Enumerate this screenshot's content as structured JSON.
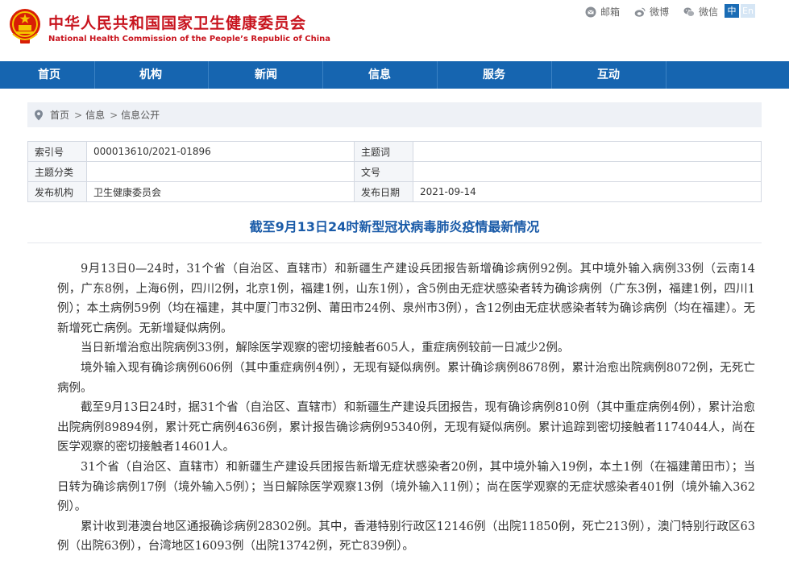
{
  "header": {
    "title_cn": "中华人民共和国国家卫生健康委员会",
    "title_en": "National Health Commission of the People’s Republic of China",
    "top_links": [
      {
        "label": "邮箱",
        "icon": "mail-icon"
      },
      {
        "label": "微博",
        "icon": "weibo-icon"
      },
      {
        "label": "微信",
        "icon": "wechat-icon"
      }
    ],
    "lang_zh": "中",
    "lang_en": "En"
  },
  "nav": {
    "items": [
      "首页",
      "机构",
      "新闻",
      "信息",
      "服务",
      "互动"
    ]
  },
  "breadcrumb": {
    "items": [
      "首页",
      "信息",
      "信息公开"
    ],
    "separator": ">"
  },
  "meta": {
    "index_label": "索引号",
    "index_value": "000013610/2021-01896",
    "subject_label": "主题词",
    "subject_value": "",
    "category_label": "主题分类",
    "category_value": "",
    "docno_label": "文号",
    "docno_value": "",
    "publisher_label": "发布机构",
    "publisher_value": "卫生健康委员会",
    "date_label": "发布日期",
    "date_value": "2021-09-14"
  },
  "article": {
    "title": "截至9月13日24时新型冠状病毒肺炎疫情最新情况",
    "paragraphs": [
      "9月13日0—24时，31个省（自治区、直辖市）和新疆生产建设兵团报告新增确诊病例92例。其中境外输入病例33例（云南14例，广东8例，上海6例，四川2例，北京1例，福建1例，山东1例），含5例由无症状感染者转为确诊病例（广东3例，福建1例，四川1例）；本土病例59例（均在福建，其中厦门市32例、莆田市24例、泉州市3例），含12例由无症状感染者转为确诊病例（均在福建）。无新增死亡病例。无新增疑似病例。",
      "当日新增治愈出院病例33例，解除医学观察的密切接触者605人，重症病例较前一日减少2例。",
      "境外输入现有确诊病例606例（其中重症病例4例），无现有疑似病例。累计确诊病例8678例，累计治愈出院病例8072例，无死亡病例。",
      "截至9月13日24时，据31个省（自治区、直辖市）和新疆生产建设兵团报告，现有确诊病例810例（其中重症病例4例），累计治愈出院病例89894例，累计死亡病例4636例，累计报告确诊病例95340例，无现有疑似病例。累计追踪到密切接触者1174044人，尚在医学观察的密切接触者14601人。",
      "31个省（自治区、直辖市）和新疆生产建设兵团报告新增无症状感染者20例，其中境外输入19例，本土1例（在福建莆田市）；当日转为确诊病例17例（境外输入5例）；当日解除医学观察13例（境外输入11例）；尚在医学观察的无症状感染者401例（境外输入362例）。",
      "累计收到港澳台地区通报确诊病例28302例。其中，香港特别行政区12146例（出院11850例，死亡213例），澳门特别行政区63例（出院63例），台湾地区16093例（出院13742例，死亡839例）。"
    ]
  },
  "colors": {
    "brand_red": "#c8141e",
    "nav_blue": "#1665b0",
    "title_blue": "#1a5ba8"
  }
}
